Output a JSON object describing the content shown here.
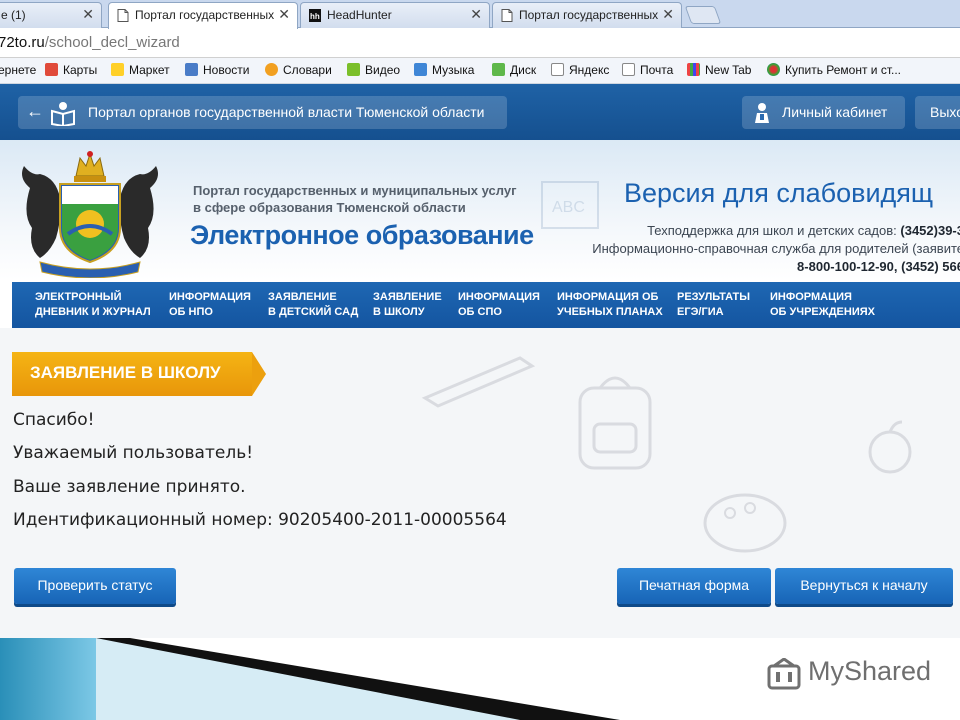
{
  "browser": {
    "tabs": [
      {
        "title": "е (1)"
      },
      {
        "title": "Портал государственных"
      },
      {
        "title": "HeadHunter"
      },
      {
        "title": "Портал государственных"
      }
    ],
    "address": {
      "host": "72to.ru",
      "path": "/school_decl_wizard"
    },
    "bookmarks": [
      {
        "label": "ернете"
      },
      {
        "label": "Карты"
      },
      {
        "label": "Маркет"
      },
      {
        "label": "Новости"
      },
      {
        "label": "Словари"
      },
      {
        "label": "Видео"
      },
      {
        "label": "Музыка"
      },
      {
        "label": "Диск"
      },
      {
        "label": "Яндекс"
      },
      {
        "label": "Почта"
      },
      {
        "label": "New Tab"
      },
      {
        "label": "Купить Ремонт и ст..."
      }
    ]
  },
  "portal_bar": {
    "title": "Портал органов государственной власти Тюменской области",
    "cabinet": "Личный кабинет",
    "exit": "Выхо"
  },
  "header": {
    "title_line1": "Портал государственных и муниципальных услуг",
    "title_line2": "в сфере образования Тюменской области",
    "brand": "Электронное образование",
    "low_vision": "Версия для слабовидящ",
    "support_line1_text": "Техподдержка для школ и детских садов:",
    "support_line1_phone": "(3452)39-3",
    "support_line2": "Информационно-справочная служба для родителей (заявите",
    "support_line3": "8-800-100-12-90, (3452) 566"
  },
  "nav": [
    {
      "line1": "ЭЛЕКТРОННЫЙ",
      "line2": "ДНЕВНИК И ЖУРНАЛ"
    },
    {
      "line1": "ИНФОРМАЦИЯ",
      "line2": "ОБ НПО"
    },
    {
      "line1": "ЗАЯВЛЕНИЕ",
      "line2": "В ДЕТСКИЙ САД"
    },
    {
      "line1": "ЗАЯВЛЕНИЕ",
      "line2": "В ШКОЛУ"
    },
    {
      "line1": "ИНФОРМАЦИЯ",
      "line2": "ОБ СПО"
    },
    {
      "line1": "ИНФОРМАЦИЯ ОБ",
      "line2": "УЧЕБНЫХ ПЛАНАХ"
    },
    {
      "line1": "РЕЗУЛЬТАТЫ",
      "line2": "ЕГЭ/ГИА"
    },
    {
      "line1": "ИНФОРМАЦИЯ",
      "line2": "ОБ УЧРЕЖДЕНИЯХ"
    }
  ],
  "content": {
    "section_label": "ЗАЯВЛЕНИЕ В ШКОЛУ",
    "thanks": "Спасибо!",
    "greeting": "Уважаемый пользователь!",
    "accepted": "Ваше заявление принято.",
    "id_line": "Идентификационный номер: 90205400-2011-00005564",
    "btn_status": "Проверить статус",
    "btn_print": "Печатная форма",
    "btn_back": "Вернуться к началу"
  },
  "watermark": {
    "text": "MyShared"
  },
  "colors": {
    "portal_blue": "#1b61b0",
    "nav_blue": "#1455a0",
    "accent_orange": "#f5b414",
    "button_blue": "#1e6ec2"
  }
}
